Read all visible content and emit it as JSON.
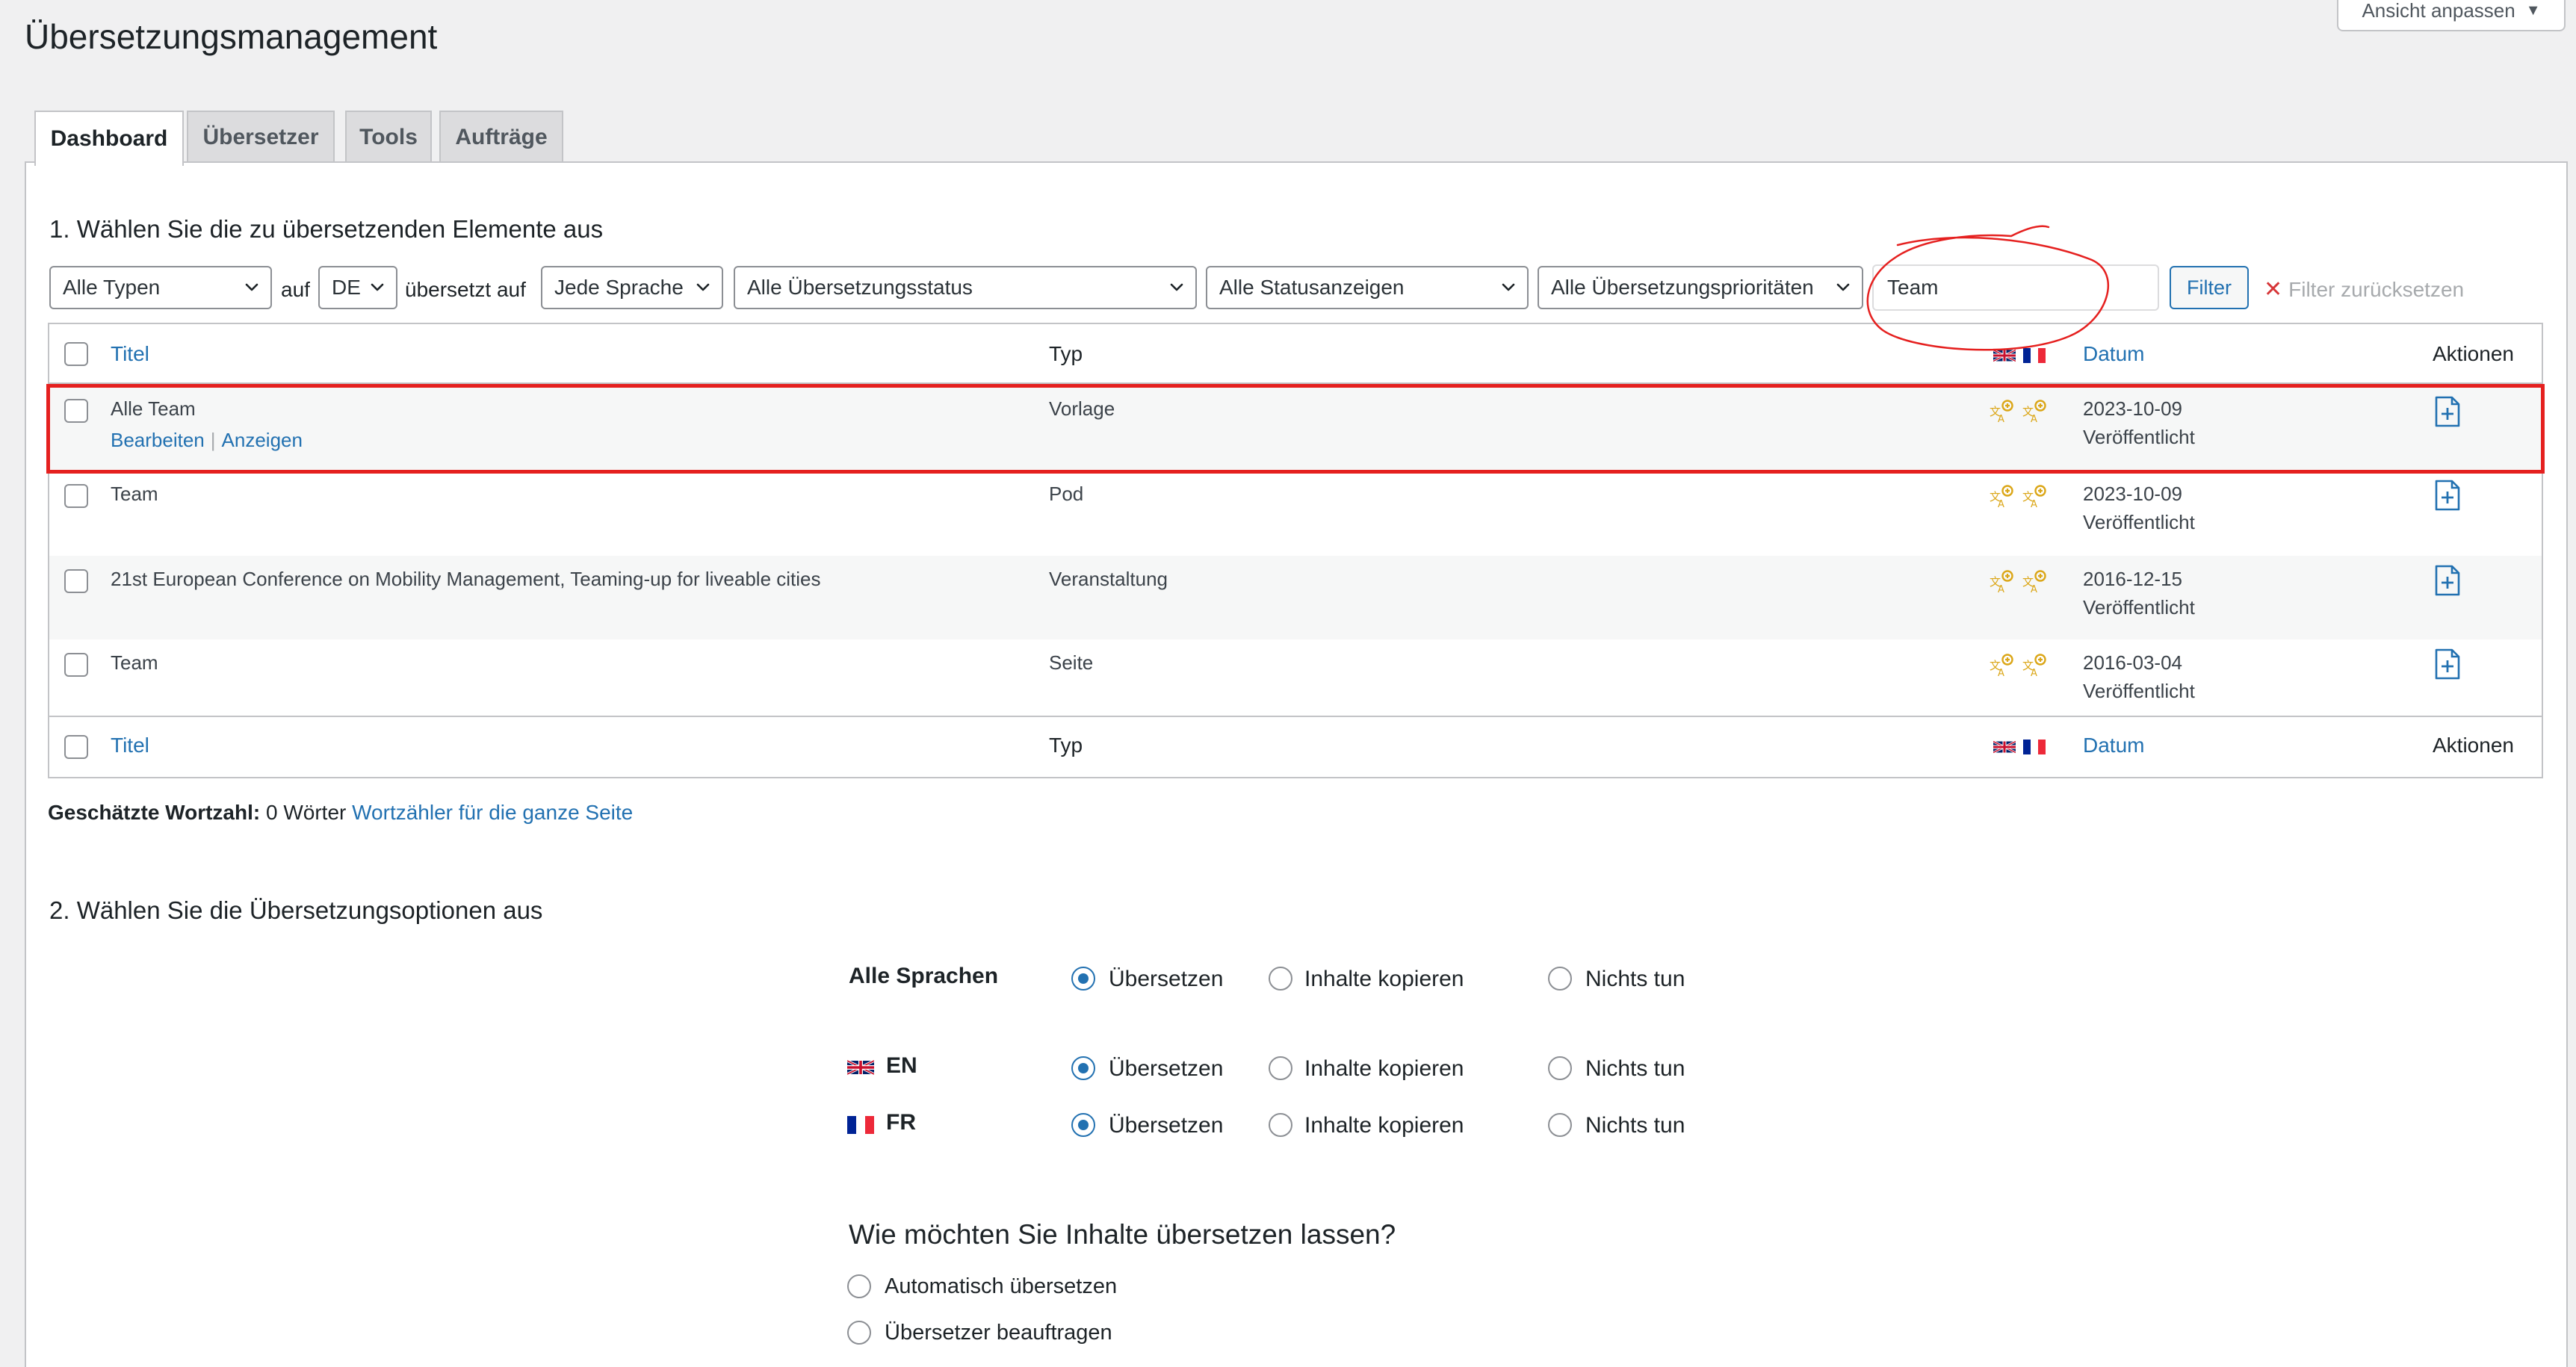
{
  "header": {
    "title": "Übersetzungsmanagement",
    "screen_options": "Ansicht anpassen"
  },
  "tabs": [
    {
      "label": "Dashboard",
      "active": true
    },
    {
      "label": "Übersetzer",
      "active": false
    },
    {
      "label": "Tools",
      "active": false
    },
    {
      "label": "Aufträge",
      "active": false
    }
  ],
  "section1": {
    "heading": "1. Wählen Sie die zu übersetzenden Elemente aus",
    "filters": {
      "type": "Alle Typen",
      "on_label": "auf",
      "source_lang": "DE",
      "translated_on_label": "übersetzt auf",
      "target_lang": "Jede Sprache",
      "translation_status": "Alle Übersetzungsstatus",
      "status_display": "Alle Statusanzeigen",
      "priority": "Alle Übersetzungsprioritäten",
      "search_value": "Team",
      "filter_button": "Filter",
      "reset": "Filter zurücksetzen"
    },
    "table": {
      "columns": {
        "title": "Titel",
        "type": "Typ",
        "date": "Datum",
        "actions": "Aktionen"
      },
      "rows": [
        {
          "title": "Alle Team",
          "type": "Vorlage",
          "date": "2023-10-09",
          "status": "Veröffentlicht",
          "row_actions": [
            "Bearbeiten",
            "Anzeigen"
          ],
          "highlighted": true
        },
        {
          "title": "Team",
          "type": "Pod",
          "date": "2023-10-09",
          "status": "Veröffentlicht"
        },
        {
          "title": "21st European Conference on Mobility Management, Teaming-up for liveable cities",
          "type": "Veranstaltung",
          "date": "2016-12-15",
          "status": "Veröffentlicht"
        },
        {
          "title": "Team",
          "type": "Seite",
          "date": "2016-03-04",
          "status": "Veröffentlicht"
        }
      ]
    },
    "word_count": {
      "label": "Geschätzte Wortzahl:",
      "value": "0 Wörter",
      "link": "Wortzähler für die ganze Seite"
    }
  },
  "section2": {
    "heading": "2. Wählen Sie die Übersetzungsoptionen aus",
    "options": [
      {
        "label": "Alle Sprachen",
        "flag": null,
        "choices": [
          "Übersetzen",
          "Inhalte kopieren",
          "Nichts tun"
        ],
        "selected": 0
      },
      {
        "label": "EN",
        "flag": "uk-flag",
        "choices": [
          "Übersetzen",
          "Inhalte kopieren",
          "Nichts tun"
        ],
        "selected": 0
      },
      {
        "label": "FR",
        "flag": "fr-flag",
        "choices": [
          "Übersetzen",
          "Inhalte kopieren",
          "Nichts tun"
        ],
        "selected": 0
      }
    ],
    "question": "Wie möchten Sie Inhalte übersetzen lassen?",
    "methods": [
      "Automatisch übersetzen",
      "Übersetzer beauftragen"
    ]
  },
  "colors": {
    "accent": "#2271b1",
    "highlight": "#e5201f",
    "status_icon": "#dba617"
  }
}
